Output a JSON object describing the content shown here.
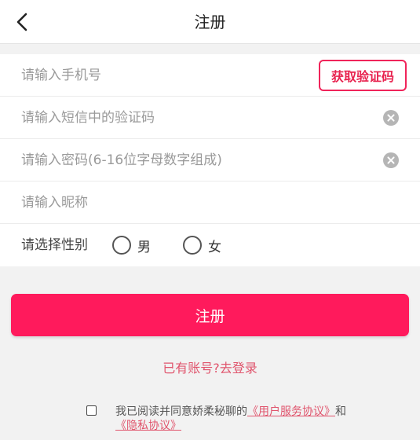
{
  "header": {
    "back_icon": "chevron-left-icon",
    "title": "注册"
  },
  "form": {
    "phone_placeholder": "请输入手机号",
    "get_code_label": "获取验证码",
    "sms_code_placeholder": "请输入短信中的验证码",
    "password_placeholder": "请输入密码(6-16位字母数字组成)",
    "nickname_placeholder": "请输入昵称",
    "gender_label": "请选择性别",
    "gender_options": [
      "男",
      "女"
    ],
    "clear_icon": "clear-circle-icon"
  },
  "submit_label": "注册",
  "login_link": "已有账号?去登录",
  "agreement": {
    "prefix": "我已阅读并同意娇柔秘聊的",
    "user_agreement": "《用户服务协议》",
    "connector": "和",
    "privacy_policy": "《隐私协议》"
  },
  "colors": {
    "accent": "#ff1a5c",
    "link": "#e0556d"
  }
}
